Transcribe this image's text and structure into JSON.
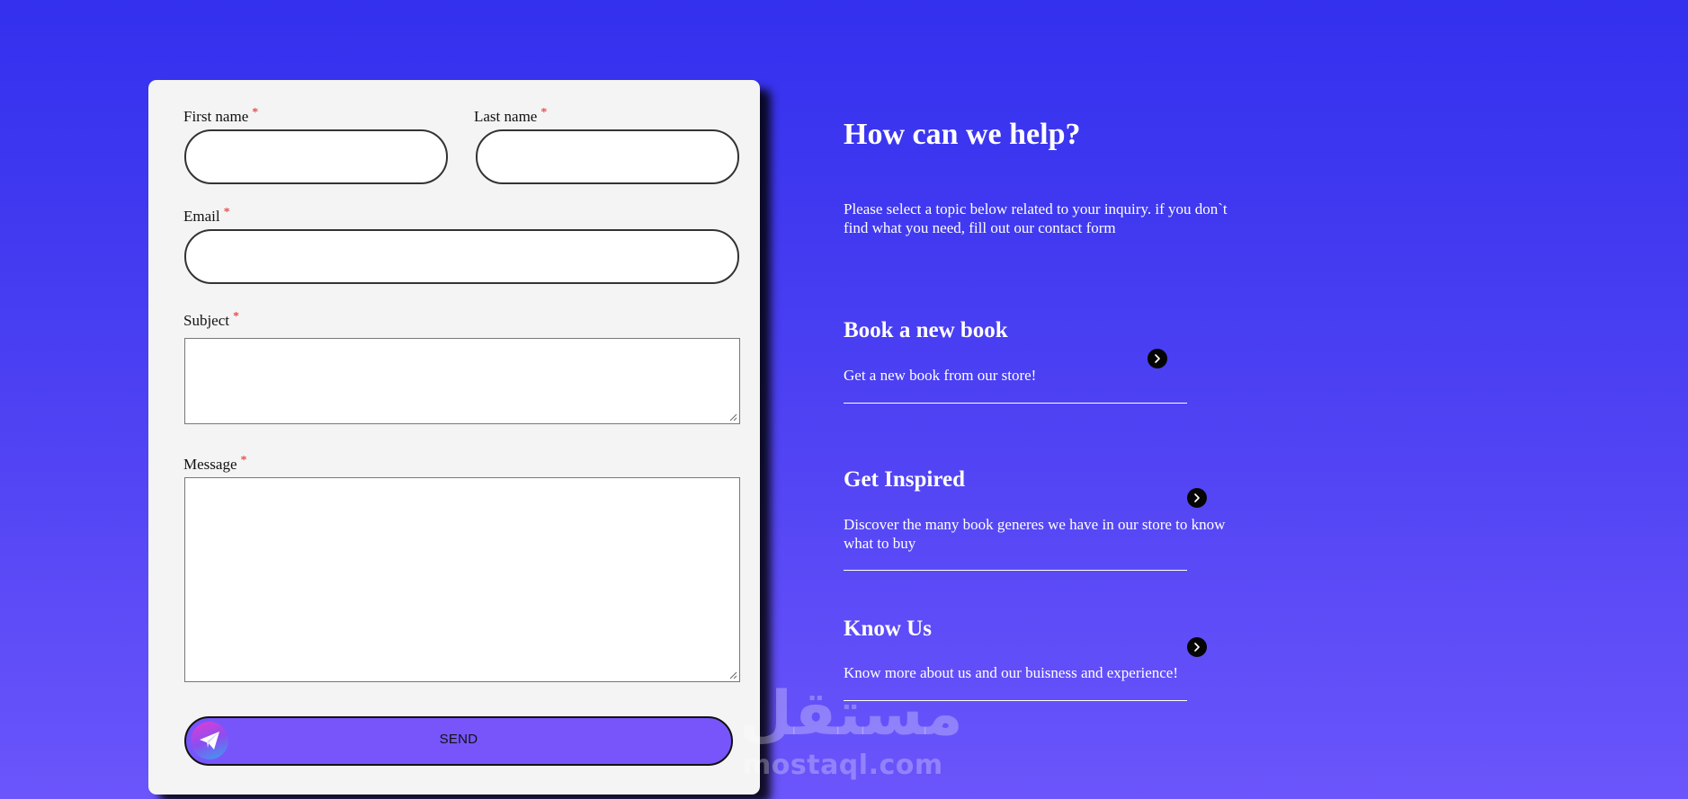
{
  "form": {
    "first_name": {
      "label": "First name",
      "required_mark": "*",
      "value": ""
    },
    "last_name": {
      "label": "Last name",
      "required_mark": "*",
      "value": ""
    },
    "email": {
      "label": "Email",
      "required_mark": "*",
      "value": ""
    },
    "subject": {
      "label": "Subject",
      "required_mark": "*",
      "value": ""
    },
    "message": {
      "label": "Message",
      "required_mark": "*",
      "value": ""
    },
    "send_label": "SEND",
    "send_icon": "paper-plane-icon"
  },
  "help": {
    "title": "How can we help?",
    "text": "Please select a topic below related to your inquiry. if you don`t find what you need, fill out our contact form",
    "topics": [
      {
        "title": "Book a new book",
        "description": "Get a new book from our store!",
        "icon": "chevron-right-icon"
      },
      {
        "title": "Get Inspired",
        "description": "Discover the many book generes we have in our store to know what to buy",
        "icon": "chevron-right-icon"
      },
      {
        "title": "Know Us",
        "description": "Know more about us and our buisness and experience!",
        "icon": "chevron-right-icon"
      }
    ]
  },
  "watermark": {
    "arabic": "مستقل",
    "latin": "mostaql.com"
  },
  "colors": {
    "background_top": "#3330ee",
    "background_bottom": "#6b55fb",
    "card": "#f4f4f4",
    "send_button": "#7755fb",
    "required_mark": "#e02020"
  }
}
